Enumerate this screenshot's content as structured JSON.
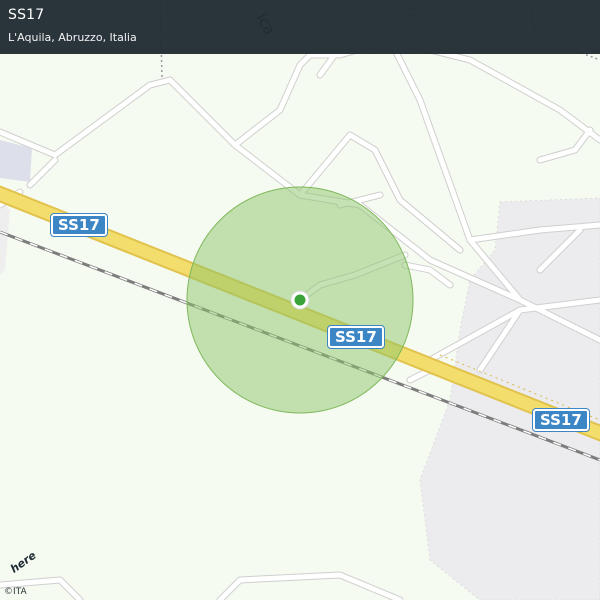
{
  "header": {
    "title": "SS17",
    "subtitle": "L'Aquila, Abruzzo, Italia"
  },
  "map": {
    "road_shield_label": "SS17",
    "street_label_fragment": "ica",
    "logo_text": "here",
    "copyright": "©ITA",
    "colors": {
      "background": "#f6fbf1",
      "main_road": "#f3dd6d",
      "main_road_casing": "#e1c24c",
      "minor_road": "#ffffff",
      "minor_road_casing": "#cfcfcf",
      "railway": "#7d7d7d",
      "built_area": "#ececee",
      "accuracy_circle": "#8cc66a",
      "location_dot": "#3aa33a",
      "shield_fill": "#3d86c6",
      "header_bg": "#1f2a30"
    }
  }
}
